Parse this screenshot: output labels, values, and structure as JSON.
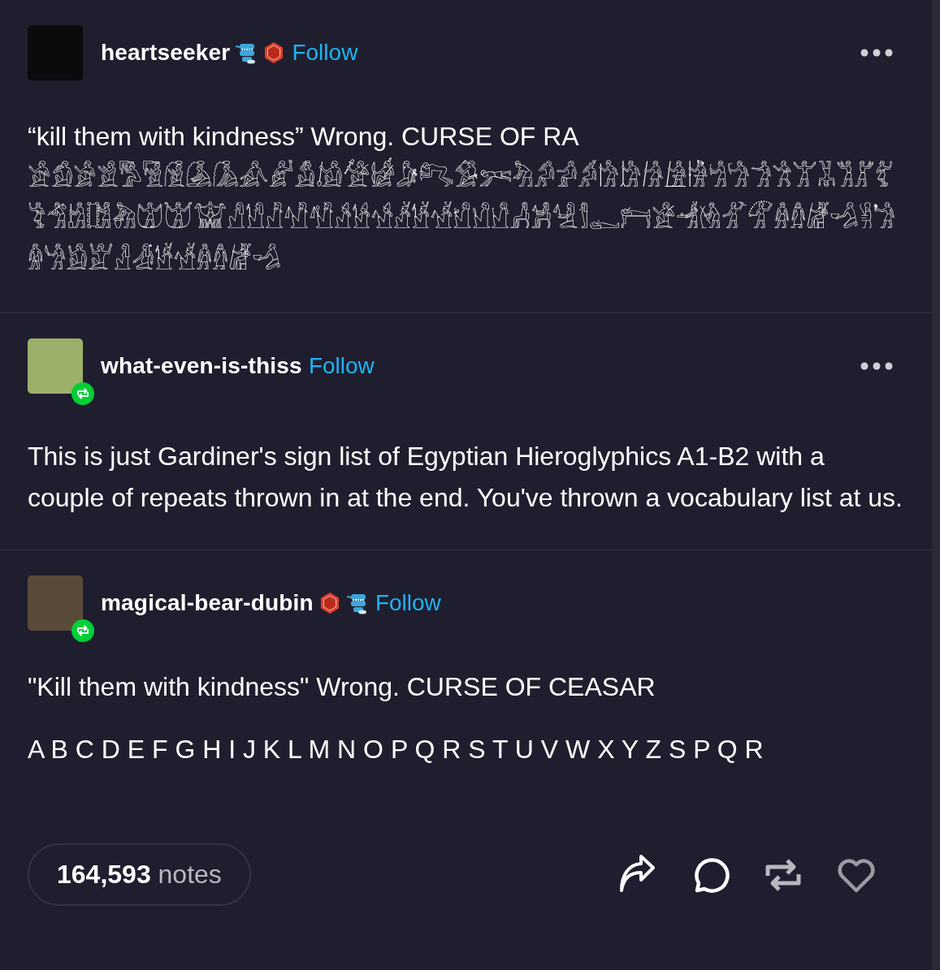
{
  "posts": [
    {
      "username": "heartseeker",
      "badges": [
        {
          "kind": "teeth"
        },
        {
          "kind": "hexagon"
        }
      ],
      "follow": "Follow",
      "menu": true,
      "reblog_badge": false,
      "paragraphs": [
        "“kill them with kindness” Wrong. CURSE OF RA 𓀀𓀁𓀂𓀃𓀄𓀅𓀆𓀇𓀈𓀉𓀊𓀋𓀌𓀍𓀎𓀏𓀐𓀑𓀒𓀓𓀔𓀕𓀖𓀗𓀘𓀙𓀚𓀛𓀜𓀝𓀞𓀟𓀠𓀡𓀢𓀣𓀤𓀥𓀦𓀧𓀨𓀩𓀪𓀫𓀬𓀭𓀮𓀯𓀰𓀱𓀲𓀳𓀴𓀵𓀶𓀷𓀸𓀹𓀺𓀻𓀼𓀽𓀾𓀿𓁀𓁁𓁂𓁃𓁄𓁅𓁆𓁇𓁈𓁉𓁊𓁋𓁌𓁍𓁎𓁏𓁐𓁑𓀶𓀷𓁆𓁇𓁈𓁉"
      ]
    },
    {
      "username": "what-even-is-thiss",
      "follow": "Follow",
      "menu": true,
      "reblog_badge": true,
      "paragraphs": [
        "This is just Gardiner's sign list of Egyptian Hieroglyphics A1-B2 with a couple of repeats thrown in at the end. You've thrown a vocabulary list at us."
      ]
    },
    {
      "username": "magical-bear-dubin",
      "badges": [
        {
          "kind": "hexagon"
        },
        {
          "kind": "teeth"
        }
      ],
      "follow": "Follow",
      "menu": false,
      "reblog_badge": true,
      "paragraphs": [
        "\"Kill them with kindness\" Wrong. CURSE OF CEASAR",
        "A B C D E F G H I J K L M N O P Q R S T U V W X Y Z S P Q R"
      ]
    }
  ],
  "footer": {
    "notes_count": "164,593",
    "notes_label": "notes",
    "liked": false
  }
}
